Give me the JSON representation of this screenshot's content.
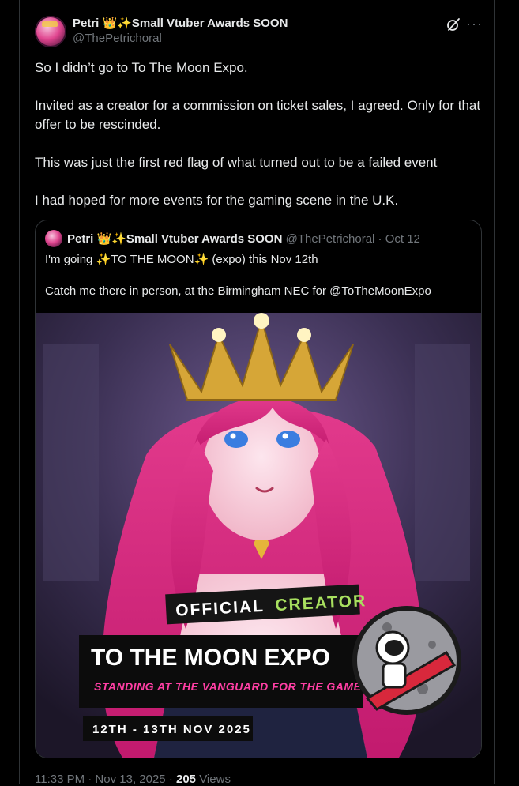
{
  "post": {
    "author_name": "Petri 👑✨Small Vtuber Awards SOON",
    "author_handle": "@ThePetrichoral",
    "paragraphs": [
      "So I didn’t go to To The Moon Expo.",
      "Invited as a creator for a commission on ticket sales, I agreed. Only for that offer to be rescinded.",
      "This was just the first red flag of what turned out to be a failed event",
      "I had hoped for more events for the gaming scene in the U.K."
    ],
    "timestamp": "11:33 PM · Nov 13, 2025",
    "views_count": "205",
    "views_label": "Views"
  },
  "quote": {
    "author_name": "Petri 👑✨Small Vtuber Awards SOON",
    "author_meta": "@ThePetrichoral · Oct 12",
    "line1": "I'm going ✨TO THE MOON✨ (expo) this Nov 12th",
    "line2": "Catch me there in person, at the Birmingham NEC for @ToTheMoonExpo"
  },
  "poster": {
    "badge_word1": "OFFICIAL",
    "badge_word2": "CREATOR",
    "title": "TO THE MOON EXPO",
    "subtitle": "STANDING AT THE VANGUARD FOR THE GAMERS",
    "dates": "12TH - 13TH NOV 2025"
  },
  "colors": {
    "background": "#000000",
    "text": "#e7e9ea",
    "muted": "#71767b",
    "border": "#2f3336",
    "badge_green": "#a8e05f",
    "subtitle_pink": "#ff3fa4"
  },
  "icons": {
    "grok": "grok-icon",
    "more": "more-icon"
  }
}
